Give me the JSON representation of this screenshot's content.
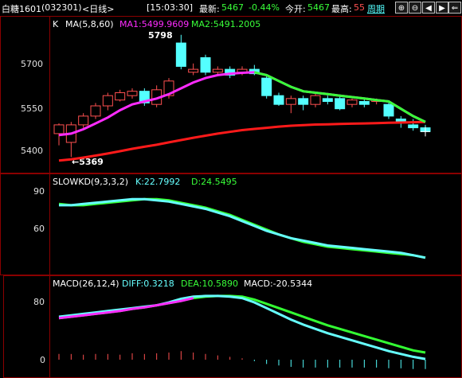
{
  "topbar": {
    "instrument": "白糖1601",
    "code": "(032301)",
    "period": "<日线>",
    "time": "[15:03:30]",
    "latest_label": "最新:",
    "latest_value": "5467",
    "change_pct": "-0.44%",
    "open_label": "今开:",
    "open_value": "5467",
    "high_label": "最高:",
    "high_value": "55",
    "period_button": "周期",
    "nav_buttons": [
      "⊕",
      "⊖",
      "◀",
      "▶",
      "⇐"
    ]
  },
  "kline_panel": {
    "indicator_k": "K",
    "ma_title": "MA(5,8,60)",
    "ma1_text": "MA1:5499.9609",
    "ma2_text": "MA2:5491.2005",
    "y_ticks": [
      "5700",
      "5550",
      "5400"
    ],
    "high_mark": "5798",
    "low_mark": "←5369"
  },
  "kd_panel": {
    "title": "SLOWKD(9,3,3,2)",
    "k_text": "K:22.7992",
    "d_text": "D:24.5495",
    "y_ticks": [
      "90",
      "60"
    ]
  },
  "macd_panel": {
    "title": "MACD(26,12,4)",
    "diff_text": "DIFF:0.3218",
    "dea_text": "DEA:10.5890",
    "macd_text": "MACD:-20.5344",
    "y_ticks": [
      "80",
      "0"
    ]
  },
  "colors": {
    "up_candle": "#ff5050",
    "down_candle": "#54ffff",
    "ma1": "#ff2bff",
    "ma2_green": "#39ff39",
    "ma60": "#ff1a1a",
    "kd_k": "#66ffff",
    "kd_d": "#33ff33",
    "macd_dea": "#33ff33",
    "macd_diff": "#66ffff",
    "border": "#8b0000"
  },
  "chart_data": {
    "type": "candlestick",
    "ylim": [
      5340,
      5830
    ],
    "candles": [
      {
        "o": 5460,
        "c": 5490,
        "h": 5495,
        "l": 5420
      },
      {
        "o": 5430,
        "c": 5490,
        "h": 5500,
        "l": 5380
      },
      {
        "o": 5490,
        "c": 5520,
        "h": 5530,
        "l": 5480
      },
      {
        "o": 5520,
        "c": 5555,
        "h": 5565,
        "l": 5510
      },
      {
        "o": 5555,
        "c": 5590,
        "h": 5600,
        "l": 5540
      },
      {
        "o": 5575,
        "c": 5600,
        "h": 5610,
        "l": 5570
      },
      {
        "o": 5590,
        "c": 5605,
        "h": 5615,
        "l": 5580
      },
      {
        "o": 5605,
        "c": 5565,
        "h": 5615,
        "l": 5555
      },
      {
        "o": 5560,
        "c": 5610,
        "h": 5625,
        "l": 5550
      },
      {
        "o": 5590,
        "c": 5640,
        "h": 5650,
        "l": 5580
      },
      {
        "o": 5770,
        "c": 5690,
        "h": 5798,
        "l": 5680
      },
      {
        "o": 5670,
        "c": 5680,
        "h": 5700,
        "l": 5660
      },
      {
        "o": 5720,
        "c": 5670,
        "h": 5730,
        "l": 5660
      },
      {
        "o": 5670,
        "c": 5680,
        "h": 5690,
        "l": 5660
      },
      {
        "o": 5680,
        "c": 5660,
        "h": 5690,
        "l": 5650
      },
      {
        "o": 5670,
        "c": 5680,
        "h": 5690,
        "l": 5660
      },
      {
        "o": 5680,
        "c": 5665,
        "h": 5695,
        "l": 5660
      },
      {
        "o": 5650,
        "c": 5590,
        "h": 5660,
        "l": 5580
      },
      {
        "o": 5590,
        "c": 5560,
        "h": 5600,
        "l": 5555
      },
      {
        "o": 5560,
        "c": 5580,
        "h": 5590,
        "l": 5530
      },
      {
        "o": 5580,
        "c": 5560,
        "h": 5590,
        "l": 5540
      },
      {
        "o": 5560,
        "c": 5590,
        "h": 5600,
        "l": 5550
      },
      {
        "o": 5580,
        "c": 5570,
        "h": 5590,
        "l": 5560
      },
      {
        "o": 5580,
        "c": 5545,
        "h": 5590,
        "l": 5540
      },
      {
        "o": 5560,
        "c": 5575,
        "h": 5580,
        "l": 5550
      },
      {
        "o": 5570,
        "c": 5560,
        "h": 5580,
        "l": 5550
      },
      {
        "o": 5570,
        "c": 5575,
        "h": 5580,
        "l": 5560
      },
      {
        "o": 5560,
        "c": 5520,
        "h": 5565,
        "l": 5510
      },
      {
        "o": 5510,
        "c": 5500,
        "h": 5520,
        "l": 5480
      },
      {
        "o": 5490,
        "c": 5480,
        "h": 5510,
        "l": 5470
      },
      {
        "o": 5480,
        "c": 5467,
        "h": 5490,
        "l": 5460
      }
    ],
    "ma_fast": [
      5455,
      5460,
      5475,
      5495,
      5515,
      5540,
      5560,
      5570,
      5580,
      5595,
      5615,
      5635,
      5650,
      5660,
      5665,
      5668,
      5670,
      5660,
      5640,
      5620,
      5605,
      5600,
      5595,
      5590,
      5585,
      5580,
      5575,
      5570,
      5545,
      5520,
      5500
    ],
    "ma_slow": [
      5368,
      5372,
      5378,
      5385,
      5392,
      5400,
      5408,
      5415,
      5422,
      5430,
      5438,
      5446,
      5453,
      5460,
      5466,
      5472,
      5476,
      5480,
      5484,
      5487,
      5489,
      5491,
      5492,
      5493,
      5494,
      5495,
      5496,
      5497,
      5498,
      5499,
      5500
    ],
    "kd_k": [
      79,
      79,
      80,
      81,
      82,
      83,
      84,
      84,
      83,
      82,
      80,
      78,
      76,
      73,
      70,
      66,
      62,
      58,
      55,
      52,
      50,
      48,
      46,
      45,
      44,
      43,
      42,
      41,
      40,
      38,
      36
    ],
    "kd_d": [
      80,
      79,
      79,
      80,
      81,
      82,
      83,
      84,
      84,
      83,
      81,
      79,
      77,
      74,
      71,
      67,
      63,
      59,
      55,
      52,
      49,
      47,
      45,
      44,
      43,
      42,
      41,
      40,
      39,
      38,
      36
    ],
    "macd_diff": [
      60,
      62,
      64,
      66,
      68,
      70,
      72,
      74,
      76,
      80,
      85,
      88,
      89,
      89,
      88,
      86,
      80,
      72,
      64,
      56,
      49,
      43,
      37,
      32,
      27,
      22,
      17,
      12,
      8,
      4,
      1
    ],
    "macd_dea": [
      58,
      60,
      62,
      64,
      66,
      68,
      71,
      73,
      76,
      79,
      82,
      86,
      88,
      89,
      89,
      88,
      84,
      78,
      72,
      66,
      60,
      54,
      48,
      43,
      38,
      33,
      28,
      23,
      18,
      13,
      10
    ],
    "macd_hist": [
      8,
      8,
      7,
      8,
      8,
      7,
      9,
      8,
      9,
      10,
      12,
      10,
      8,
      6,
      4,
      2,
      -2,
      -6,
      -8,
      -10,
      -11,
      -11,
      -11,
      -11,
      -11,
      -11,
      -11,
      -12,
      -12,
      -13,
      -13
    ]
  }
}
